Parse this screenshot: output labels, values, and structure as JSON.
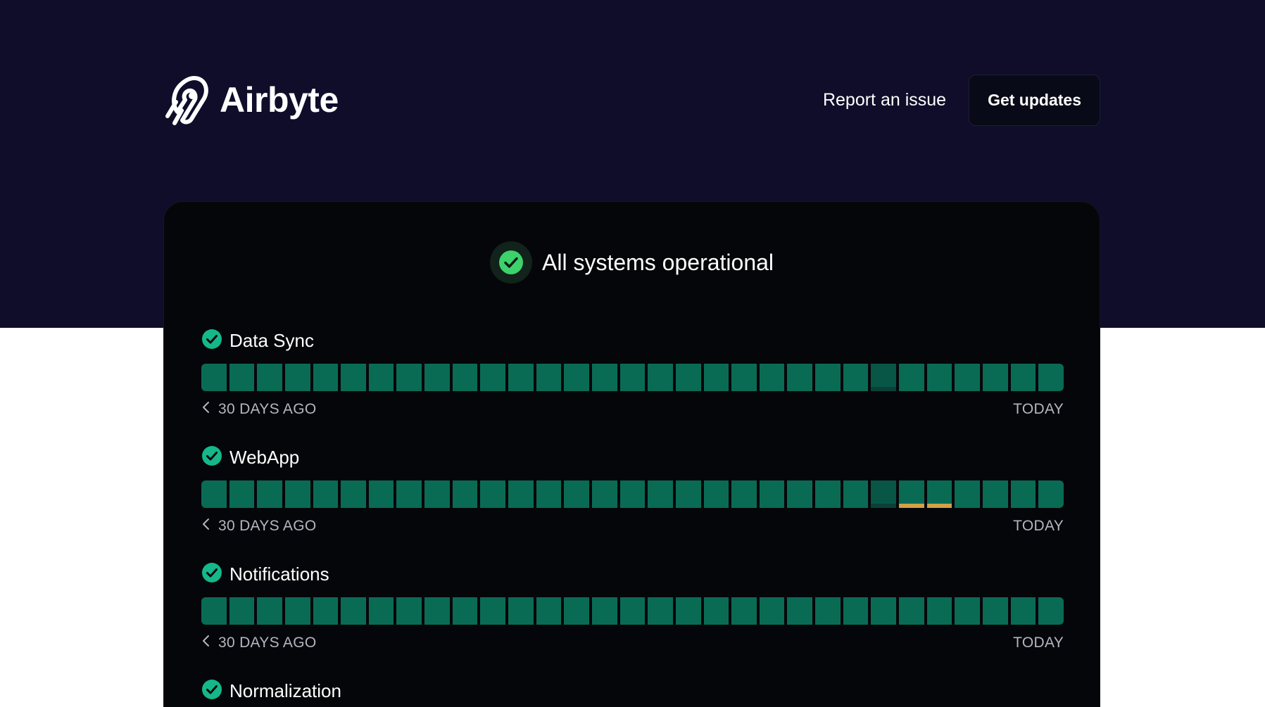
{
  "brand": {
    "name": "Airbyte"
  },
  "nav": {
    "report_label": "Report an issue",
    "updates_label": "Get updates"
  },
  "overall_status": {
    "text": "All systems operational",
    "color": "#3cd26c"
  },
  "colors": {
    "hero_bg": "#0f0d29",
    "card_bg": "#05060a",
    "operational": "#0a6b55",
    "minor": "#d3a146"
  },
  "range_labels": {
    "start": "30 DAYS AGO",
    "end": "TODAY"
  },
  "components": [
    {
      "name": "Data Sync",
      "status_icon": "check-circle-icon",
      "days": [
        "ok",
        "ok",
        "ok",
        "ok",
        "ok",
        "ok",
        "ok",
        "ok",
        "ok",
        "ok",
        "ok",
        "ok",
        "ok",
        "ok",
        "ok",
        "ok",
        "ok",
        "ok",
        "ok",
        "ok",
        "ok",
        "ok",
        "ok",
        "ok",
        "dim",
        "ok",
        "ok",
        "ok",
        "ok",
        "ok",
        "ok"
      ]
    },
    {
      "name": "WebApp",
      "status_icon": "check-circle-icon",
      "days": [
        "ok",
        "ok",
        "ok",
        "ok",
        "ok",
        "ok",
        "ok",
        "ok",
        "ok",
        "ok",
        "ok",
        "ok",
        "ok",
        "ok",
        "ok",
        "ok",
        "ok",
        "ok",
        "ok",
        "ok",
        "ok",
        "ok",
        "ok",
        "ok",
        "dim",
        "minor",
        "minor",
        "ok",
        "ok",
        "ok",
        "ok"
      ]
    },
    {
      "name": "Notifications",
      "status_icon": "check-circle-icon",
      "days": [
        "ok",
        "ok",
        "ok",
        "ok",
        "ok",
        "ok",
        "ok",
        "ok",
        "ok",
        "ok",
        "ok",
        "ok",
        "ok",
        "ok",
        "ok",
        "ok",
        "ok",
        "ok",
        "ok",
        "ok",
        "ok",
        "ok",
        "ok",
        "ok",
        "ok",
        "ok",
        "ok",
        "ok",
        "ok",
        "ok",
        "ok"
      ]
    },
    {
      "name": "Normalization",
      "status_icon": "check-circle-icon",
      "days": []
    }
  ]
}
